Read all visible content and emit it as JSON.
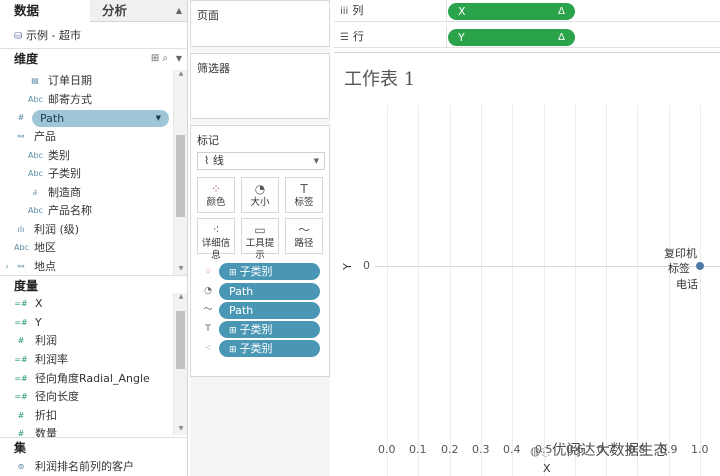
{
  "tabs": {
    "data": "数据",
    "analysis": "分析"
  },
  "datasource": "示例 - 超市",
  "dimensions": {
    "header": "维度",
    "fields": [
      {
        "label": "订单日期",
        "icon": "calendar-icon"
      },
      {
        "label": "邮寄方式",
        "icon": "abc-icon"
      },
      {
        "label": "Path",
        "icon": "number-icon"
      },
      {
        "label": "产品",
        "icon": "hierarchy-icon"
      },
      {
        "label": "类别",
        "icon": "abc-icon"
      },
      {
        "label": "子类别",
        "icon": "abc-icon"
      },
      {
        "label": "制造商",
        "icon": "link-icon"
      },
      {
        "label": "产品名称",
        "icon": "abc-icon"
      },
      {
        "label": "利润 (级)",
        "icon": "bin-icon"
      },
      {
        "label": "地区",
        "icon": "abc-icon"
      },
      {
        "label": "地点",
        "icon": "hierarchy-icon"
      }
    ]
  },
  "measures": {
    "header": "度量",
    "fields": [
      {
        "label": "X",
        "icon": "calc-number-icon"
      },
      {
        "label": "Y",
        "icon": "calc-number-icon"
      },
      {
        "label": "利润",
        "icon": "number-icon"
      },
      {
        "label": "利润率",
        "icon": "calc-number-icon"
      },
      {
        "label": "径向角度Radial_Angle",
        "icon": "calc-number-icon"
      },
      {
        "label": "径向长度",
        "icon": "calc-number-icon"
      },
      {
        "label": "折扣",
        "icon": "number-icon"
      },
      {
        "label": "数量",
        "icon": "number-icon"
      }
    ]
  },
  "sets": {
    "header": "集",
    "fields": [
      {
        "label": "利润排名前列的客户"
      }
    ]
  },
  "pages_card": {
    "title": "页面"
  },
  "filters_card": {
    "title": "筛选器"
  },
  "marks_card": {
    "title": "标记",
    "mark_type": "线",
    "buttons": [
      {
        "label": "颜色",
        "icon": "color-dots-icon"
      },
      {
        "label": "大小",
        "icon": "size-icon"
      },
      {
        "label": "标签",
        "icon": "label-icon"
      },
      {
        "label": "详细信息",
        "icon": "detail-icon"
      },
      {
        "label": "工具提示",
        "icon": "tooltip-icon"
      },
      {
        "label": "路径",
        "icon": "path-icon"
      }
    ],
    "pills": [
      {
        "label": "子类别",
        "icon": "color-dots-icon"
      },
      {
        "label": "Path",
        "icon": "size-icon"
      },
      {
        "label": "Path",
        "icon": "path-icon"
      },
      {
        "label": "子类别",
        "icon": "label-icon"
      },
      {
        "label": "子类别",
        "icon": "detail-icon"
      }
    ]
  },
  "shelves": {
    "columns": {
      "label": "列",
      "pill": "X"
    },
    "rows": {
      "label": "行",
      "pill": "Y"
    }
  },
  "worksheet": {
    "title": "工作表 1",
    "point_labels": [
      "复印机",
      "标签",
      "电话"
    ],
    "watermark": "优阅达大数据生态"
  },
  "chart_data": {
    "type": "line",
    "title": "工作表 1",
    "xlabel": "X",
    "ylabel": "Y",
    "x_ticks": [
      "0.0",
      "0.1",
      "0.2",
      "0.3",
      "0.4",
      "0.5",
      "0.6",
      "0.7",
      "0.8",
      "0.9",
      "1.0"
    ],
    "y_ticks": [
      "0"
    ],
    "xlim": [
      0,
      1.0
    ],
    "points": [
      {
        "x": 1.0,
        "y": 0
      }
    ],
    "grid": true
  },
  "colors": {
    "green_pill": "#2aa34a",
    "blue_pill": "#4a97b5",
    "mark": "#4e79a7"
  }
}
